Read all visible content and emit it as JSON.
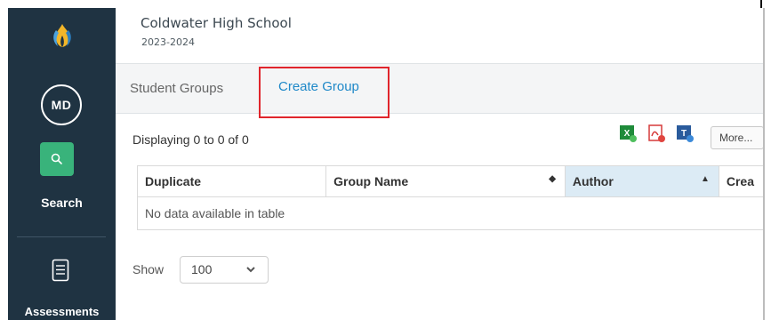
{
  "header": {
    "school_name": "Coldwater High School",
    "school_year": "2023-2024"
  },
  "sidebar": {
    "avatar_initials": "MD",
    "items": [
      {
        "label": "Search",
        "icon": "search-icon",
        "accent": "#39b37b"
      },
      {
        "label": "Assessments",
        "icon": "document-icon"
      }
    ],
    "background": "#1f3342"
  },
  "tabs": [
    {
      "label": "Student Groups",
      "active": false
    },
    {
      "label": "Create Group",
      "active": true,
      "highlighted": true
    }
  ],
  "toolbar": {
    "display_count": "Displaying 0 to 0 of 0",
    "export_icons": [
      "excel-icon",
      "pdf-icon",
      "text-export-icon"
    ],
    "more_label": "More..."
  },
  "table": {
    "columns": [
      {
        "label": "Duplicate"
      },
      {
        "label": "Group Name",
        "sort": "both"
      },
      {
        "label": "Author",
        "sort": "asc"
      },
      {
        "label": "Crea"
      }
    ],
    "empty_message": "No data available in table"
  },
  "pagination": {
    "show_label": "Show",
    "page_size": "100"
  },
  "colors": {
    "link_blue": "#1e88c8",
    "highlight_red": "#e0252c",
    "sorted_header": "#dcebf5"
  }
}
